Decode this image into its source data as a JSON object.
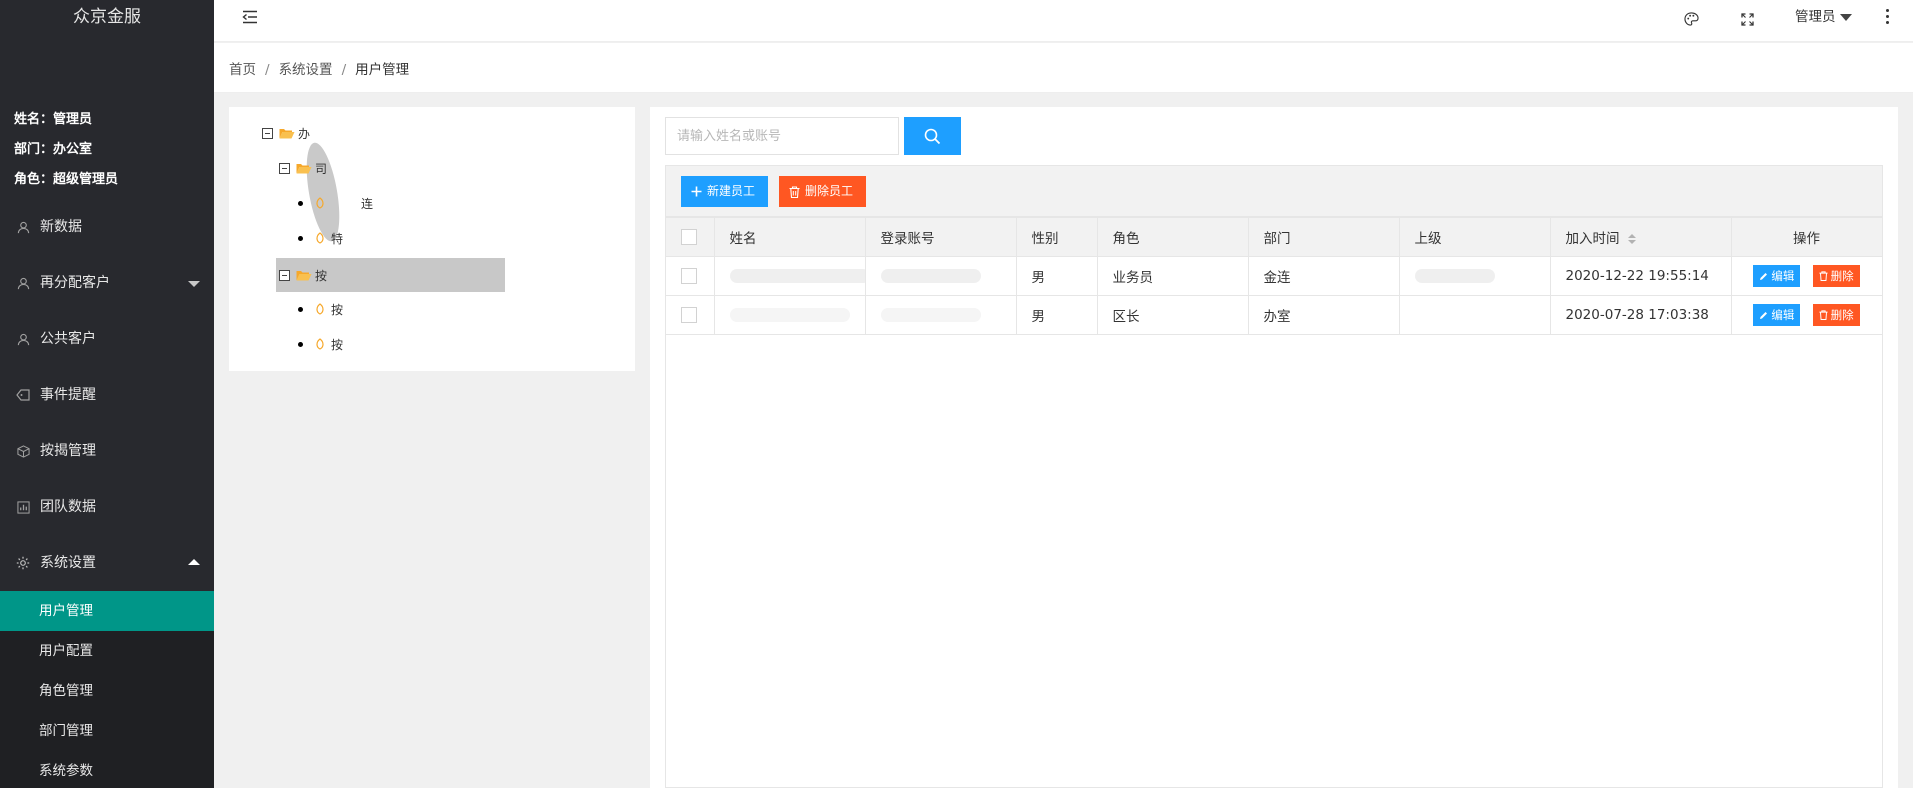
{
  "app": {
    "brand": "众京金服"
  },
  "user": {
    "name_line": "姓名：管理员",
    "dept_line": "部门：办公室",
    "role_line": "角色：超级管理员"
  },
  "sidebar": {
    "items": [
      {
        "label": "新数据",
        "icon": "user-icon"
      },
      {
        "label": "再分配客户",
        "icon": "user-icon"
      },
      {
        "label": "公共客户",
        "icon": "user-icon"
      },
      {
        "label": "事件提醒",
        "icon": "tag-icon"
      },
      {
        "label": "按揭管理",
        "icon": "cube-icon"
      },
      {
        "label": "团队数据",
        "icon": "chart-icon"
      },
      {
        "label": "系统设置",
        "icon": "gear-icon"
      }
    ],
    "subitems": [
      "用户管理",
      "用户配置",
      "角色管理",
      "部门管理",
      "系统参数"
    ]
  },
  "header": {
    "admin_label": "管理员"
  },
  "breadcrumb": {
    "home": "首页",
    "section": "系统设置",
    "current": "用户管理"
  },
  "tree": {
    "nodes": [
      "办",
      "司",
      "连",
      "特",
      "按",
      "按",
      "按"
    ]
  },
  "search": {
    "placeholder": "请输入姓名或账号"
  },
  "toolbar": {
    "add_label": "新建员工",
    "delete_label": "删除员工"
  },
  "table": {
    "columns": [
      "姓名",
      "登录账号",
      "性别",
      "角色",
      "部门",
      "上级",
      "加入时间",
      "操作"
    ],
    "rows": [
      {
        "name": "",
        "account": "",
        "gender": "男",
        "role": "业务员",
        "dept": "金连",
        "leader": "",
        "joined": "2020-12-22 19:55:14"
      },
      {
        "name": "",
        "account": "",
        "gender": "男",
        "role": "区长",
        "dept": "办室",
        "leader": "",
        "joined": "2020-07-28 17:03:38"
      }
    ],
    "edit_label": "编辑",
    "delete_label": "删除"
  },
  "colors": {
    "sidebar_bg": "#28292e",
    "active": "#009688",
    "primary": "#1e9fff",
    "danger": "#ff5722"
  }
}
